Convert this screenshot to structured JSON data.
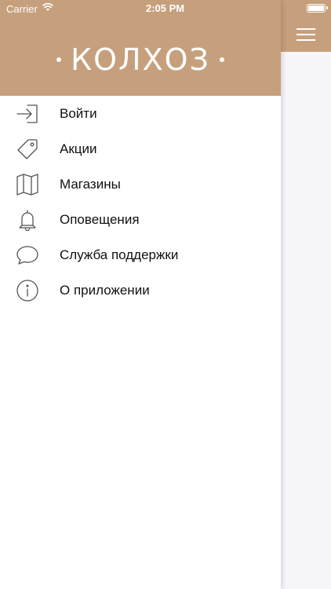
{
  "status_bar": {
    "carrier": "Carrier",
    "time": "2:05 PM"
  },
  "header": {
    "logo_text": "КОЛХОЗ",
    "background_color": "#c6a07c"
  },
  "menu": {
    "items": [
      {
        "label": "Войти",
        "icon": "login-icon"
      },
      {
        "label": "Акции",
        "icon": "tag-icon"
      },
      {
        "label": "Магазины",
        "icon": "map-icon"
      },
      {
        "label": "Оповещения",
        "icon": "bell-icon"
      },
      {
        "label": "Служба поддержки",
        "icon": "chat-bubble-icon"
      },
      {
        "label": "О приложении",
        "icon": "info-icon"
      }
    ]
  }
}
